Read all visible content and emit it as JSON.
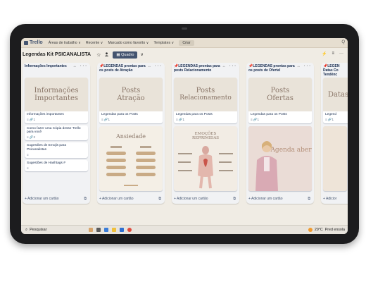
{
  "topbar": {
    "logo": "Trello",
    "nav": [
      "Áreas de trabalho ∨",
      "Recente ∨",
      "Marcado como favorito ∨",
      "Templates ∨"
    ],
    "create": "Criar",
    "search_icon": "Q"
  },
  "board": {
    "title": "Legendas Kit PSICANALISTA",
    "star_icon": "☆",
    "view_label": "Quadro",
    "view_chevron": "∨"
  },
  "lists": [
    {
      "title": "Informações Importantes",
      "icons": "↔ ···",
      "cover_line1": "Informações",
      "cover_line2": "Importantes",
      "cards": [
        {
          "text": "Informações importantes",
          "meta": "≡ 🔗1"
        },
        {
          "text": "Como fazer uma Cópia desse Trello para você",
          "meta": "≡ 🔗2"
        },
        {
          "text": "Sugestões de Emojis para Psicanalistas",
          "meta": "≡"
        },
        {
          "text": "Sugestões de Hashtags #",
          "meta": "≡"
        }
      ],
      "add": "+ Adicionar um cartão"
    },
    {
      "title": "LEGENDAS prontas para os posts de Atração",
      "icons": "↔ ···",
      "cover_line1": "Posts",
      "cover_line2": "Atração",
      "card_text": "Legendas para os Posts",
      "card_meta": "≡ 🔗1",
      "image_title": "Ansiedade",
      "add": "+ Adicionar um cartão"
    },
    {
      "title": "LEGENDAS prontas para posts Relacionamento",
      "icons": "↔ ···",
      "cover_line1": "Posts",
      "cover_line2": "Relacionamento",
      "card_text": "Legendas para os Posts",
      "card_meta": "≡ 🔗1",
      "image_title": "EMOÇÕES REPRIMIDAS",
      "add": "+ Adicionar um cartão"
    },
    {
      "title": "LEGENDAS prontas para os posts de Oferta!",
      "icons": "↔ ···",
      "cover_line1": "Posts",
      "cover_line2": "Ofertas",
      "card_text": "Legendas para os Posts",
      "card_meta": "≡ 🔗1",
      "image_title": "Agenda aberta",
      "add": "+ Adicionar um cartão"
    },
    {
      "title": "LEGEN Datas Co Tendênc",
      "cover_line1": "Datas C",
      "card_text": "Legend",
      "card_meta": "≡ 🔗1",
      "add": "+ Adicior"
    }
  ],
  "taskbar": {
    "search": "Pesquisar",
    "temperature": "29°C",
    "weather": "Pred ensola"
  },
  "colors": {
    "board_bg": "#f0ece4",
    "list_bg": "#f1f2f4",
    "accent": "#44546f",
    "cover": "#e9e3d9"
  }
}
